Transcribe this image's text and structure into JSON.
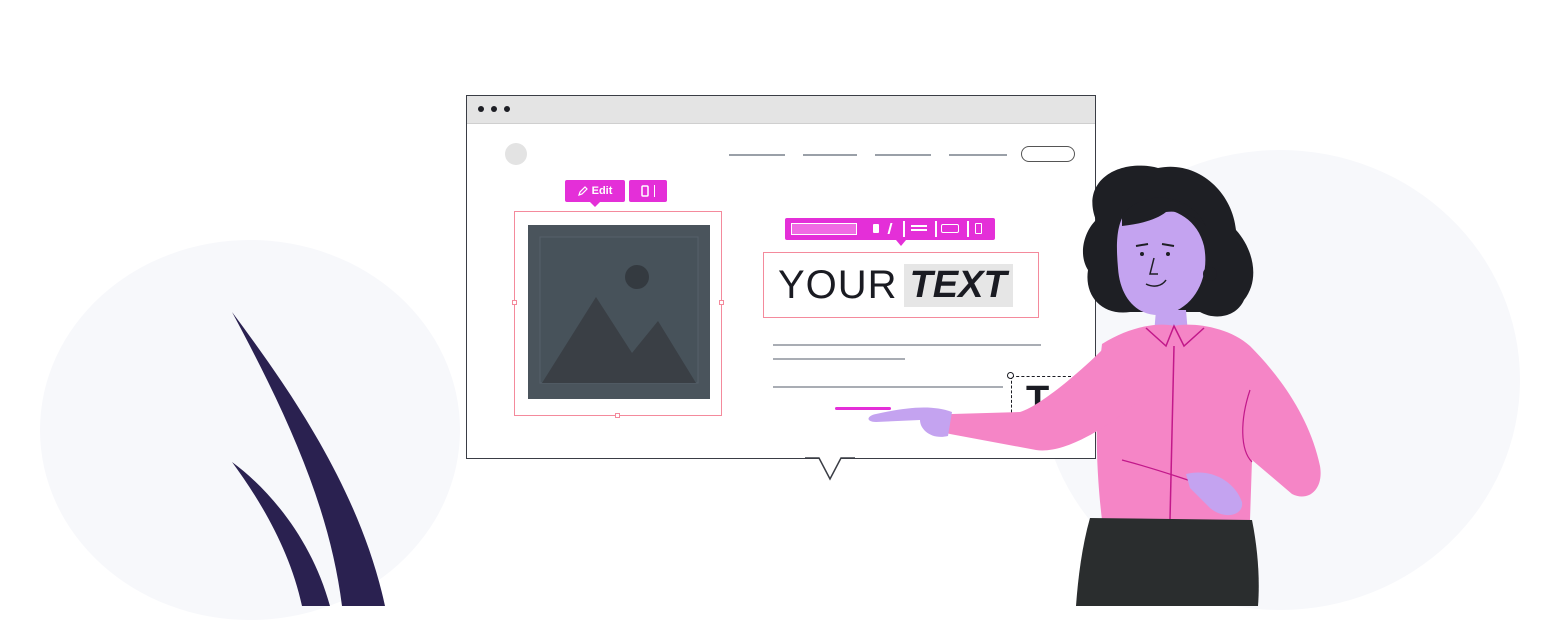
{
  "editor": {
    "image_toolbar": {
      "edit_label": "Edit"
    },
    "headline": {
      "plain": "YOUR",
      "bold": "TEXT"
    },
    "side_glyph": "T"
  },
  "colors": {
    "accent": "#e42fd8",
    "frame": "#f48a9c",
    "dark": "#1a1b22",
    "shirt": "#f585c6",
    "skin": "#c4a3f0",
    "plant": "#2a2150",
    "image_placeholder": "#4a545c"
  },
  "icons": [
    "pencil-icon",
    "copy-icon",
    "image-placeholder-icon",
    "mountain-icon"
  ]
}
